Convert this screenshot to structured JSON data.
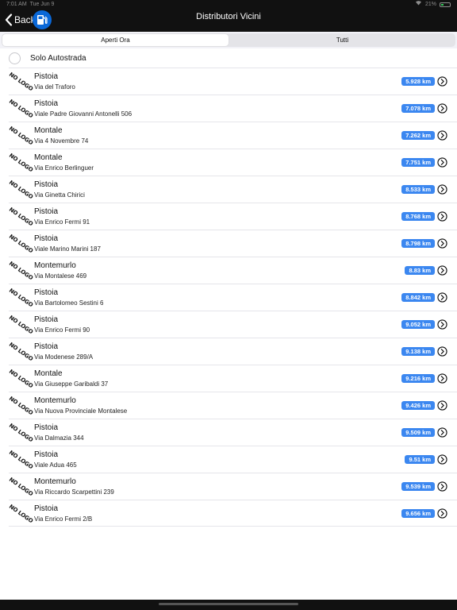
{
  "status_bar": {
    "time": "7:01 AM",
    "date": "Tue Jun 9",
    "battery": "21%",
    "wifi_icon": "wifi-icon",
    "battery_icon": "battery-icon"
  },
  "nav": {
    "back_label": "Back",
    "title": "Distributori Vicini",
    "fuel_icon": "fuel-pump-icon"
  },
  "segments": {
    "open_now": "Aperti Ora",
    "all": "Tutti",
    "selected": "Aperti Ora"
  },
  "filter": {
    "label": "Solo Autostrada",
    "checked": false
  },
  "logo_placeholder": "NO LOGO",
  "colors": {
    "badge": "#3b87f0",
    "nav_background": "#111111",
    "fuel_button": "#0a68d8"
  },
  "stations": [
    {
      "city": "Pistoia",
      "address": "Via del Traforo",
      "distance": "5.928 km"
    },
    {
      "city": "Pistoia",
      "address": "Viale Padre Giovanni Antonelli 506",
      "distance": "7.078 km"
    },
    {
      "city": "Montale",
      "address": "Via 4 Novembre 74",
      "distance": "7.262 km"
    },
    {
      "city": "Montale",
      "address": "Via Enrico Berlinguer",
      "distance": "7.751 km"
    },
    {
      "city": "Pistoia",
      "address": "Via Ginetta Chirici",
      "distance": "8.533 km"
    },
    {
      "city": "Pistoia",
      "address": "Via Enrico Fermi 91",
      "distance": "8.768 km"
    },
    {
      "city": "Pistoia",
      "address": "Viale Marino Marini 187",
      "distance": "8.798 km"
    },
    {
      "city": "Montemurlo",
      "address": "Via Montalese 469",
      "distance": "8.83 km"
    },
    {
      "city": "Pistoia",
      "address": "Via Bartolomeo Sestini 6",
      "distance": "8.842 km"
    },
    {
      "city": "Pistoia",
      "address": "Via Enrico Fermi 90",
      "distance": "9.052 km"
    },
    {
      "city": "Pistoia",
      "address": "Via Modenese 289/A",
      "distance": "9.138 km"
    },
    {
      "city": "Montale",
      "address": "Via Giuseppe Garibaldi 37",
      "distance": "9.216 km"
    },
    {
      "city": "Montemurlo",
      "address": "Via Nuova Provinciale Montalese",
      "distance": "9.426 km"
    },
    {
      "city": "Pistoia",
      "address": "Via Dalmazia 344",
      "distance": "9.509 km"
    },
    {
      "city": "Pistoia",
      "address": "Viale Adua 465",
      "distance": "9.51 km"
    },
    {
      "city": "Montemurlo",
      "address": "Via Riccardo Scarpettini 239",
      "distance": "9.539 km"
    },
    {
      "city": "Pistoia",
      "address": "Via Enrico Fermi 2/B",
      "distance": "9.656 km"
    }
  ]
}
